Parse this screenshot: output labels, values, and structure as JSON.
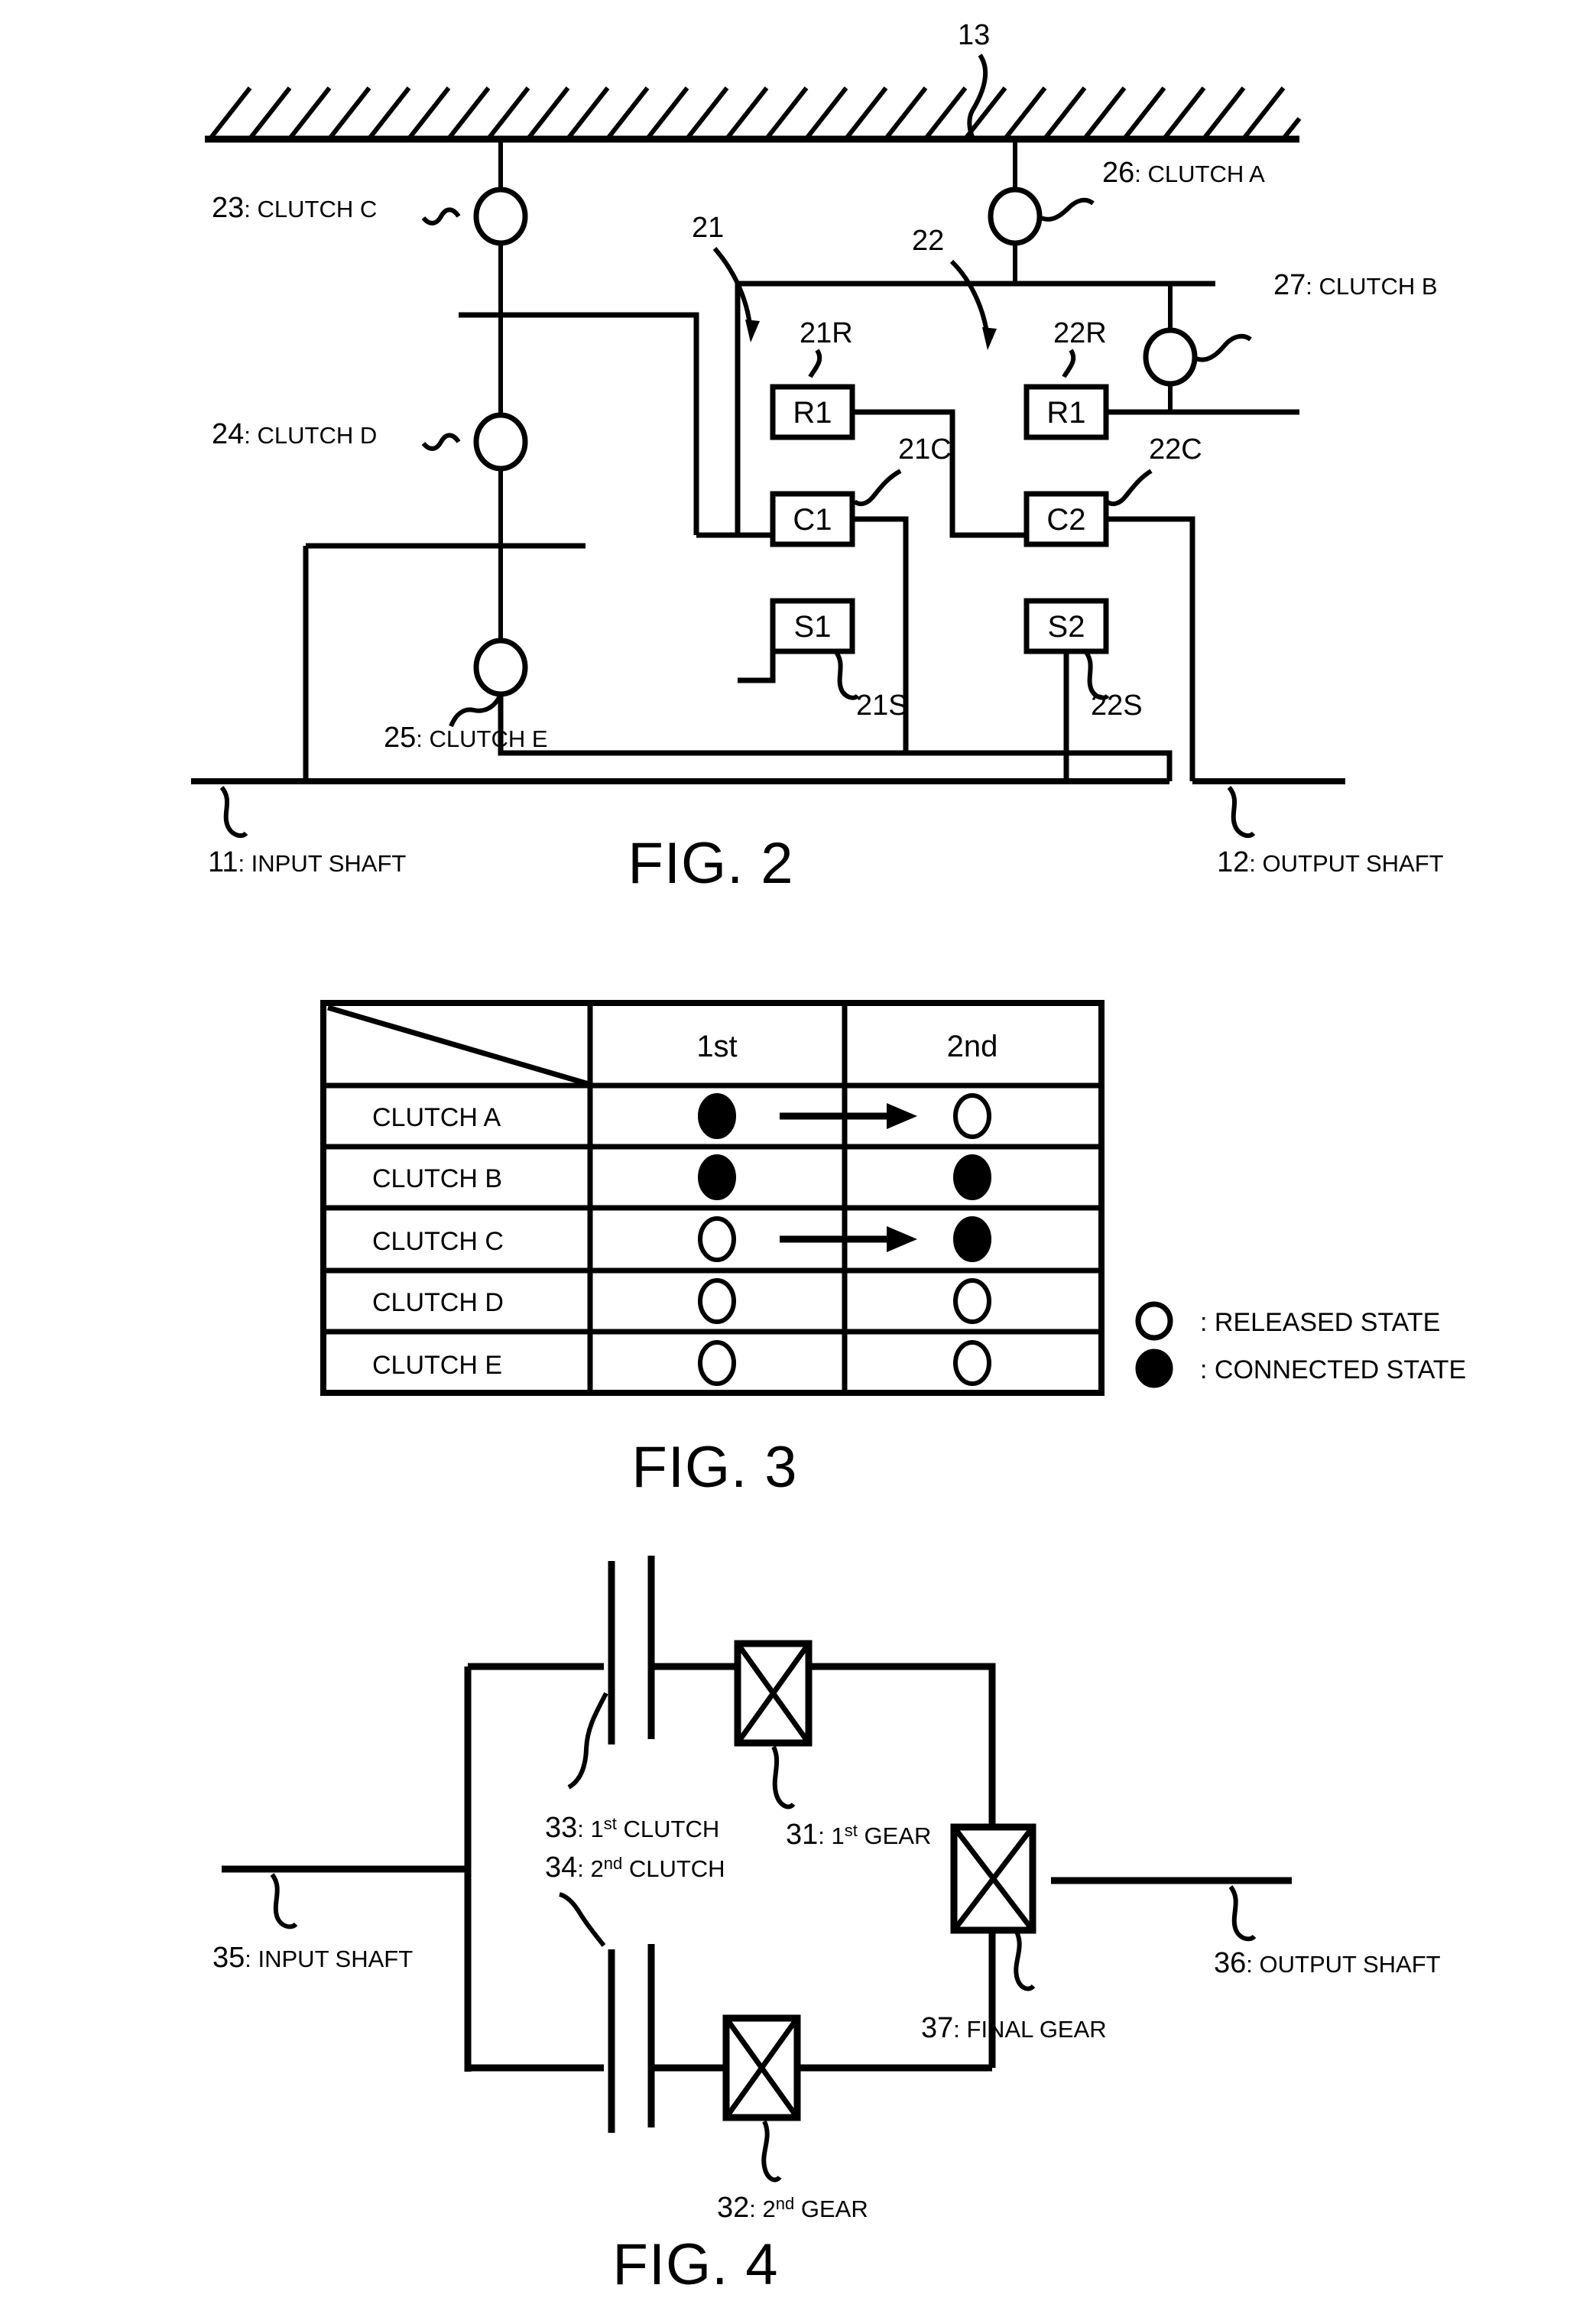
{
  "sheet": {
    "figures": [
      "FIG. 2",
      "FIG. 3",
      "FIG. 4"
    ]
  },
  "fig2": {
    "title": "FIG. 2",
    "housing_ref": "13",
    "labels": {
      "clutch_c": "23: CLUTCH C",
      "clutch_d": "24: CLUTCH D",
      "clutch_e": "25: CLUTCH E",
      "clutch_a": "26: CLUTCH A",
      "clutch_b": "27: CLUTCH B",
      "input_shaft": "11: INPUT SHAFT",
      "output_shaft": "12: OUTPUT  SHAFT"
    },
    "planetary1": {
      "ref": "21",
      "ring_ref": "21R",
      "carrier_ref": "21C",
      "sun_ref": "21S",
      "ring_box": "R1",
      "carrier_box": "C1",
      "sun_box": "S1"
    },
    "planetary2": {
      "ref": "22",
      "ring_ref": "22R",
      "carrier_ref": "22C",
      "sun_ref": "22S",
      "ring_box": "R1",
      "carrier_box": "C2",
      "sun_box": "S2"
    }
  },
  "fig3": {
    "title": "FIG. 3",
    "table": {
      "corner_cell": "",
      "columns": [
        "1st",
        "2nd"
      ],
      "rows": [
        {
          "label": "CLUTCH A",
          "states": [
            "connected",
            "released"
          ],
          "arrow": true
        },
        {
          "label": "CLUTCH B",
          "states": [
            "connected",
            "connected"
          ],
          "arrow": false
        },
        {
          "label": "CLUTCH C",
          "states": [
            "released",
            "connected"
          ],
          "arrow": true
        },
        {
          "label": "CLUTCH D",
          "states": [
            "released",
            "released"
          ],
          "arrow": false
        },
        {
          "label": "CLUTCH E",
          "states": [
            "released",
            "released"
          ],
          "arrow": false
        }
      ]
    },
    "legend": [
      {
        "symbol": "released",
        "text": ": RELEASED STATE"
      },
      {
        "symbol": "connected",
        "text": ": CONNECTED STATE"
      }
    ]
  },
  "fig4": {
    "title": "FIG. 4",
    "labels": {
      "first_gear": {
        "num": "31: ",
        "base": "1",
        "sup": "st",
        "tail": " GEAR"
      },
      "second_gear": {
        "num": "32: ",
        "base": "2",
        "sup": "nd",
        "tail": " GEAR"
      },
      "first_clutch": {
        "num": "33: ",
        "base": "1",
        "sup": "st",
        "tail": " CLUTCH"
      },
      "second_clutch": {
        "num": "34: ",
        "base": "2",
        "sup": "nd",
        "tail": " CLUTCH"
      },
      "input_shaft": "35: INPUT SHAFT",
      "output_shaft": "36: OUTPUT SHAFT",
      "final_gear": "37: FINAL GEAR"
    }
  },
  "colors": {
    "ink": "#000000",
    "paper": "#ffffff"
  }
}
